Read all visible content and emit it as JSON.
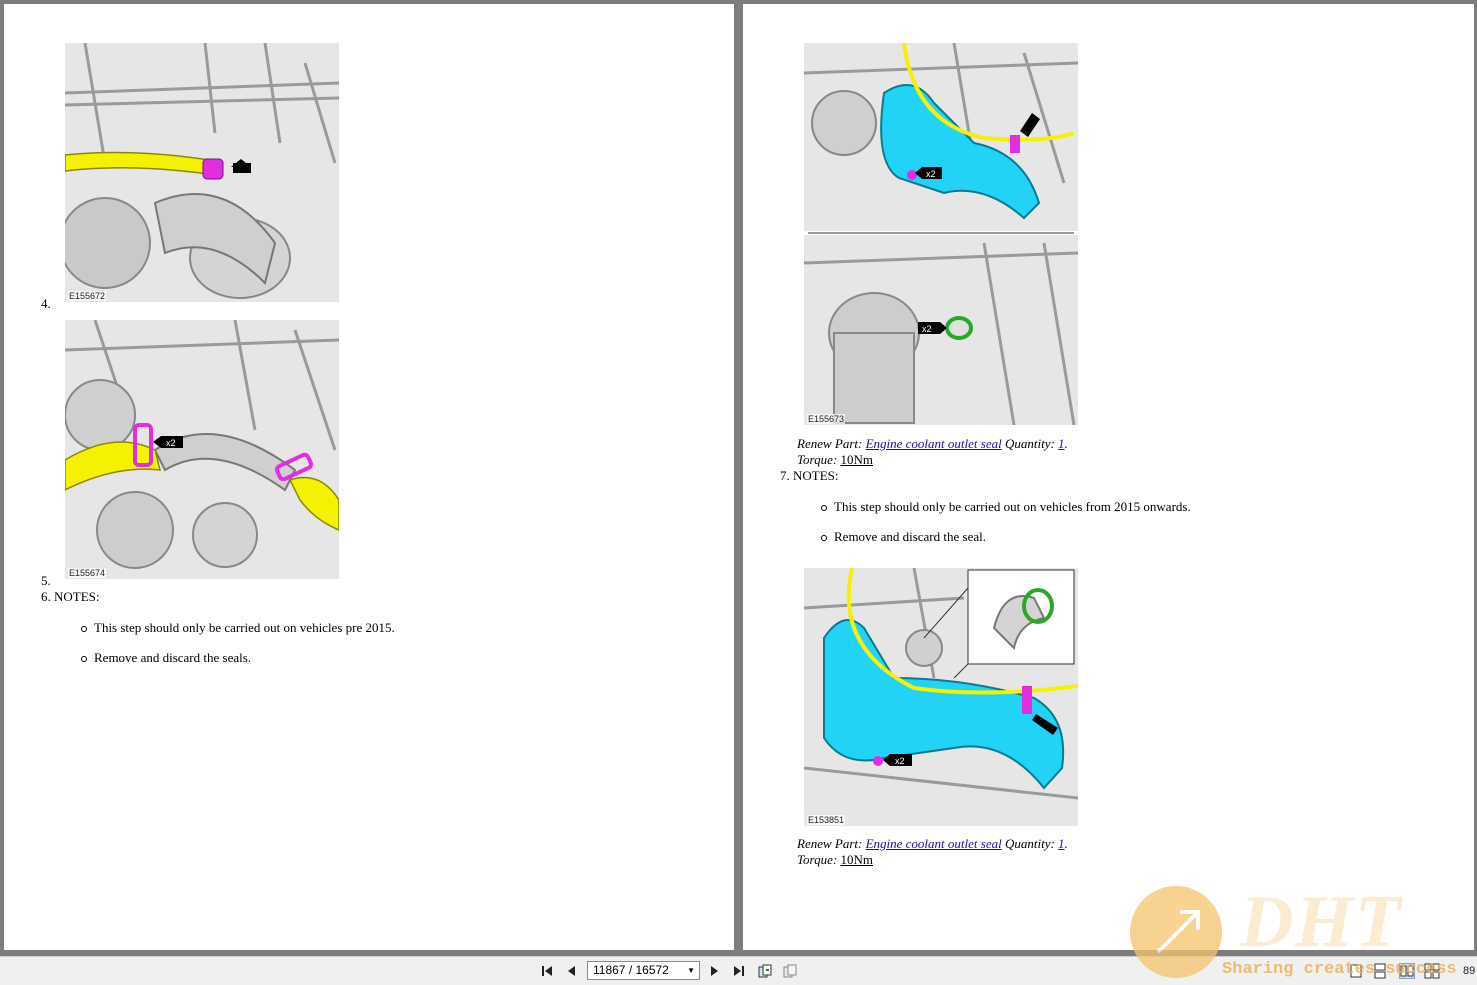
{
  "left_page": {
    "figures": [
      {
        "caption": "E155672"
      },
      {
        "caption": "E155674"
      }
    ],
    "steps": [
      {
        "number": "4."
      },
      {
        "number": "5."
      }
    ],
    "step6": {
      "label": "6. NOTES:",
      "bullets": [
        "This step should only be carried out on vehicles pre 2015.",
        "Remove and discard the seals."
      ]
    }
  },
  "right_page": {
    "figure_top": {
      "caption": "E155673",
      "callouts": [
        "x2",
        "x2"
      ]
    },
    "renew1": {
      "prefix": "Renew Part: ",
      "part": "Engine coolant outlet seal",
      "qty_label": " Quantity: ",
      "qty": "1",
      "dot": "."
    },
    "torque1": {
      "label": "Torque: ",
      "value": "10Nm"
    },
    "step7": {
      "label": "7.  NOTES:",
      "bullets": [
        "This step should only be carried out on vehicles from 2015 onwards.",
        "Remove and discard the seal."
      ]
    },
    "figure_bottom": {
      "caption": "E153851",
      "callouts": [
        "x2"
      ]
    },
    "renew2": {
      "prefix": "Renew Part: ",
      "part": "Engine coolant outlet seal",
      "qty_label": " Quantity: ",
      "qty": "1",
      "dot": "."
    },
    "torque2": {
      "label": "Torque: ",
      "value": "10Nm"
    }
  },
  "left_figure_callouts": [
    "x2"
  ],
  "toolbar": {
    "page_indicator": "11867 / 16572",
    "zoom_partial": "89",
    "icons": [
      "first-page-icon",
      "prev-page-icon",
      "next-page-icon",
      "last-page-icon",
      "rotate-icon",
      "copy-icon",
      "single-page-icon",
      "facing-pages-icon",
      "continuous-icon"
    ]
  },
  "watermark": {
    "brand": "DHT",
    "tagline": "Sharing creates success"
  },
  "colors": {
    "viewer_bg": "#7d7d7d",
    "page_bg": "#ffffff",
    "link": "#1a0dab",
    "highlight_cyan": "#22d3f5",
    "highlight_yellow": "#f5f200",
    "highlight_magenta": "#e02ee0"
  }
}
